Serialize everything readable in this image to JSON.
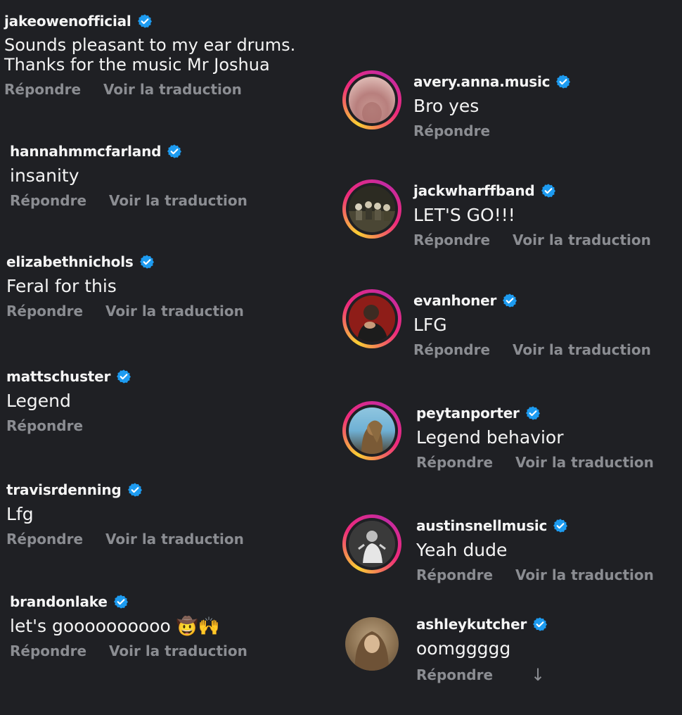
{
  "icons": {
    "verified": "verified-badge-icon",
    "arrow": "arrow-down-icon"
  },
  "colors": {
    "background": "#1f2024",
    "verified": "#1d9bf0",
    "action": "#8b8d92",
    "story_ring": [
      "#f9ce34",
      "#ee2a7b",
      "#c32aa3"
    ]
  },
  "left_comments": [
    {
      "username": "jakeowenofficial",
      "text": "Sounds pleasant to my ear drums. Thanks for the music Mr Joshua",
      "reply": "Répondre",
      "translate": "Voir la traduction"
    },
    {
      "username": "hannahmmcfarland",
      "text": "insanity",
      "reply": "Répondre",
      "translate": "Voir la traduction"
    },
    {
      "username": "elizabethnichols",
      "text": "Feral for this",
      "reply": "Répondre",
      "translate": "Voir la traduction"
    },
    {
      "username": "mattschuster",
      "text": "Legend",
      "reply": "Répondre"
    },
    {
      "username": "travisrdenning",
      "text": "Lfg",
      "reply": "Répondre",
      "translate": "Voir la traduction"
    },
    {
      "username": "brandonlake",
      "text": "let's goooooooooo 🤠🙌",
      "reply": "Répondre",
      "translate": "Voir la traduction"
    }
  ],
  "right_comments": [
    {
      "username": "avery.anna.music",
      "text": "Bro yes",
      "reply": "Répondre"
    },
    {
      "username": "jackwharffband",
      "text": "LET'S GO!!!",
      "reply": "Répondre",
      "translate": "Voir la traduction"
    },
    {
      "username": "evanhoner",
      "text": "LFG",
      "reply": "Répondre",
      "translate": "Voir la traduction"
    },
    {
      "username": "peytanporter",
      "text": "Legend behavior",
      "reply": "Répondre",
      "translate": "Voir la traduction"
    },
    {
      "username": "austinsnellmusic",
      "text": "Yeah dude",
      "reply": "Répondre",
      "translate": "Voir la traduction"
    },
    {
      "username": "ashleykutcher",
      "text": "oomggggg",
      "reply": "Répondre",
      "arrow": "↓"
    }
  ]
}
